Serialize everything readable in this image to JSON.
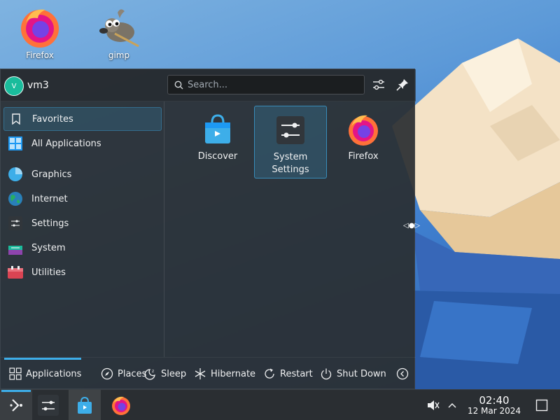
{
  "desktop": {
    "icons": [
      {
        "label": "Firefox",
        "icon": "firefox-icon"
      },
      {
        "label": "gimp",
        "icon": "gimp-icon"
      }
    ]
  },
  "launcher": {
    "user": {
      "initial": "V",
      "name": "vm3"
    },
    "search": {
      "placeholder": "Search...",
      "value": ""
    },
    "header_buttons": [
      {
        "icon": "configure-icon"
      },
      {
        "icon": "pin-icon"
      }
    ],
    "categories": [
      {
        "label": "Favorites",
        "icon": "bookmark-icon",
        "active": true
      },
      {
        "label": "All Applications",
        "icon": "grid-icon",
        "active": false
      },
      {
        "label": "Graphics",
        "icon": "graphics-icon",
        "active": false
      },
      {
        "label": "Internet",
        "icon": "globe-icon",
        "active": false
      },
      {
        "label": "Settings",
        "icon": "settings-icon",
        "active": false
      },
      {
        "label": "System",
        "icon": "system-icon",
        "active": false
      },
      {
        "label": "Utilities",
        "icon": "utilities-icon",
        "active": false
      }
    ],
    "apps": [
      {
        "label": "Discover",
        "icon": "discover-icon",
        "selected": false
      },
      {
        "label1": "System",
        "label2": "Settings",
        "icon": "system-settings-icon",
        "selected": true
      },
      {
        "label": "Firefox",
        "icon": "firefox-icon",
        "selected": false
      }
    ],
    "footer": {
      "applications": "Applications",
      "places": "Places",
      "sleep": "Sleep",
      "hibernate": "Hibernate",
      "restart": "Restart",
      "shutdown": "Shut Down"
    },
    "resize_handle": "◁●▷"
  },
  "taskbar": {
    "clock_time": "02:40",
    "clock_date": "12 Mar 2024"
  },
  "colors": {
    "accent": "#3daee9",
    "panel": "#2a2e32",
    "avatar": "#1abc9c"
  }
}
